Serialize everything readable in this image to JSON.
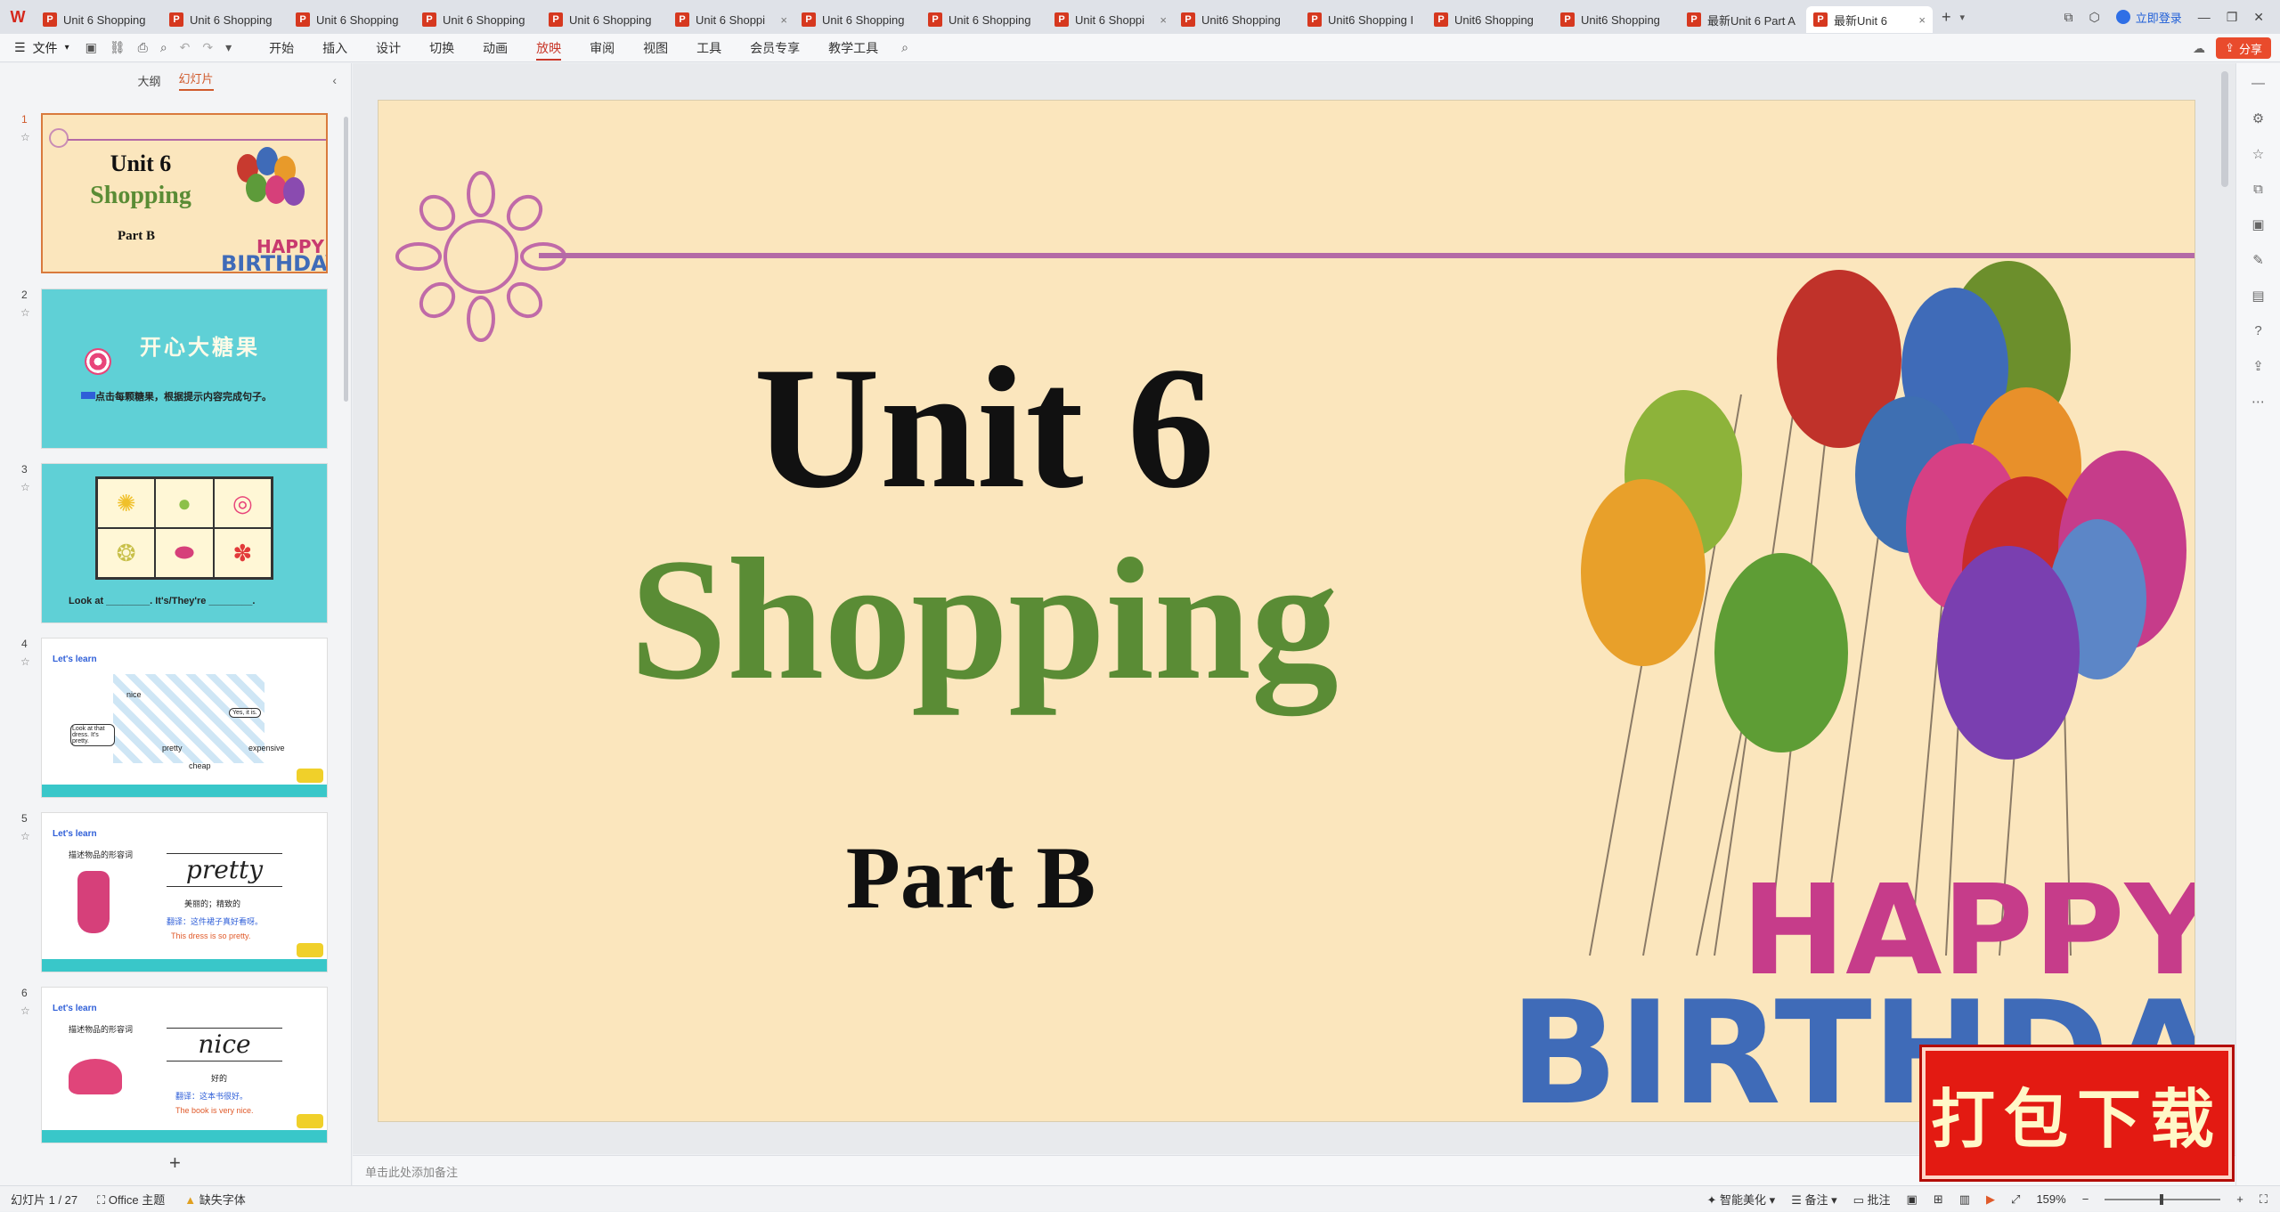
{
  "titlebar": {
    "app_logo": "W",
    "tabs": [
      {
        "label": "Unit 6 Shopping",
        "active": false,
        "closable": false
      },
      {
        "label": "Unit 6 Shopping",
        "active": false,
        "closable": false
      },
      {
        "label": "Unit 6 Shopping",
        "active": false,
        "closable": false
      },
      {
        "label": "Unit 6 Shopping",
        "active": false,
        "closable": false
      },
      {
        "label": "Unit 6 Shopping",
        "active": false,
        "closable": false
      },
      {
        "label": "Unit 6 Shoppi",
        "active": false,
        "closable": true
      },
      {
        "label": "Unit 6 Shopping",
        "active": false,
        "closable": false
      },
      {
        "label": "Unit 6 Shopping",
        "active": false,
        "closable": false
      },
      {
        "label": "Unit 6 Shoppi",
        "active": false,
        "closable": true
      },
      {
        "label": "Unit6 Shopping",
        "active": false,
        "closable": false
      },
      {
        "label": "Unit6 Shopping I",
        "active": false,
        "closable": false
      },
      {
        "label": "Unit6 Shopping",
        "active": false,
        "closable": false
      },
      {
        "label": "Unit6 Shopping",
        "active": false,
        "closable": false
      },
      {
        "label": "最新Unit 6  Part A",
        "active": false,
        "closable": false
      },
      {
        "label": "最新Unit 6",
        "active": true,
        "closable": true
      }
    ],
    "new_tab": "+",
    "login_label": "立即登录"
  },
  "menubar": {
    "file_label": "文件",
    "ribbon_tabs": [
      "开始",
      "插入",
      "设计",
      "切换",
      "动画",
      "放映",
      "审阅",
      "视图",
      "工具",
      "会员专享",
      "教学工具"
    ],
    "active_tab": "放映",
    "share_label": "分享"
  },
  "sidepanel": {
    "tab_outline": "大纲",
    "tab_slides": "幻灯片",
    "thumbnails": [
      {
        "num": "1",
        "title": "Unit 6",
        "subtitle": "Shopping",
        "part": "Part B",
        "selected": true
      },
      {
        "num": "2",
        "title": "开心大糖果",
        "caption": "点击每颗糖果，根据提示内容完成句子。"
      },
      {
        "num": "3",
        "caption": "Look at ________. It's/They're ________."
      },
      {
        "num": "4",
        "header": "Let's learn",
        "words": [
          "nice",
          "pretty",
          "cheap",
          "expensive"
        ],
        "bubble1": "Look at that dress. It's pretty.",
        "bubble2": "Yes, it is."
      },
      {
        "num": "5",
        "header": "Let's learn",
        "subheader": "描述物品的形容词",
        "word": "pretty",
        "meaning": "美丽的；精致的",
        "translate": "翻译：这件裙子真好看呀。",
        "sentence": "This dress is so pretty."
      },
      {
        "num": "6",
        "header": "Let's learn",
        "subheader": "描述物品的形容词",
        "word": "nice",
        "meaning": "好的",
        "translate": "翻译：这本书很好。",
        "sentence": "The book is very nice."
      }
    ],
    "add_slide": "+"
  },
  "slide": {
    "title": "Unit 6",
    "subtitle": "Shopping",
    "part": "Part B",
    "banner_top": "HAPPY",
    "banner_bottom": "BIRTHDAY"
  },
  "notes_placeholder": "单击此处添加备注",
  "statusbar": {
    "slide_counter": "幻灯片 1 / 27",
    "theme": "Office 主题",
    "missing_font": "缺失字体",
    "smart_beautify": "智能美化",
    "notes": "备注",
    "comments": "批注",
    "zoom": "159%"
  },
  "download_badge": "打包下载",
  "colors": {
    "slide_bg": "#fbe6bd",
    "title_green": "#5a8c35",
    "accent_red": "#c8382a",
    "line_purple": "#b46aa6"
  }
}
